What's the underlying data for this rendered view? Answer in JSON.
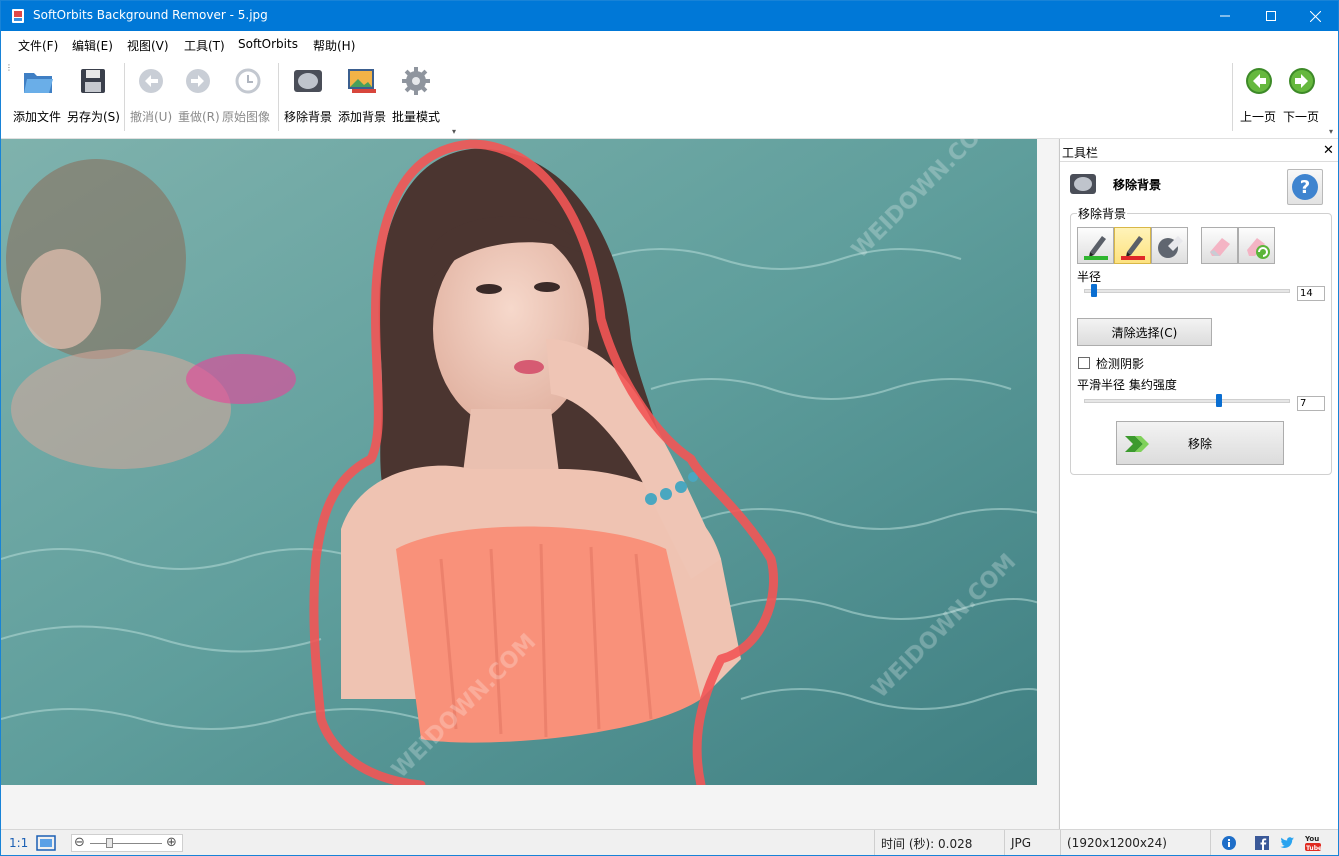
{
  "window": {
    "title": "SoftOrbits Background Remover - 5.jpg",
    "accent": "#0078d7"
  },
  "menu": [
    "文件(F)",
    "编辑(E)",
    "视图(V)",
    "工具(T)",
    "SoftOrbits",
    "帮助(H)"
  ],
  "toolbar": {
    "add_file": "添加文件",
    "save_as": "另存为(S)",
    "undo": "撤消(U)",
    "redo": "重做(R)",
    "original": "原始图像",
    "remove_bg": "移除背景",
    "add_bg": "添加背景",
    "batch": "批量模式",
    "prev": "上一页",
    "next": "下一页"
  },
  "panel": {
    "header": "工具栏",
    "section_title": "移除背景",
    "group_caption": "移除背景",
    "radius_label": "半径",
    "radius_value": "14",
    "clear_button": "清除选择(C)",
    "detect_shadow_label": "检测阴影",
    "detect_shadow_checked": false,
    "smooth_label": "平滑半径  集约强度",
    "smooth_value": "7",
    "remove_button": "移除"
  },
  "status": {
    "zoom_label": "1:1",
    "time": "时间 (秒): 0.028",
    "format": "JPG",
    "dimensions": "(1920x1200x24)"
  },
  "photo": {
    "watermark": "WEIDOWN.COM",
    "selection_color": "#f25555"
  }
}
